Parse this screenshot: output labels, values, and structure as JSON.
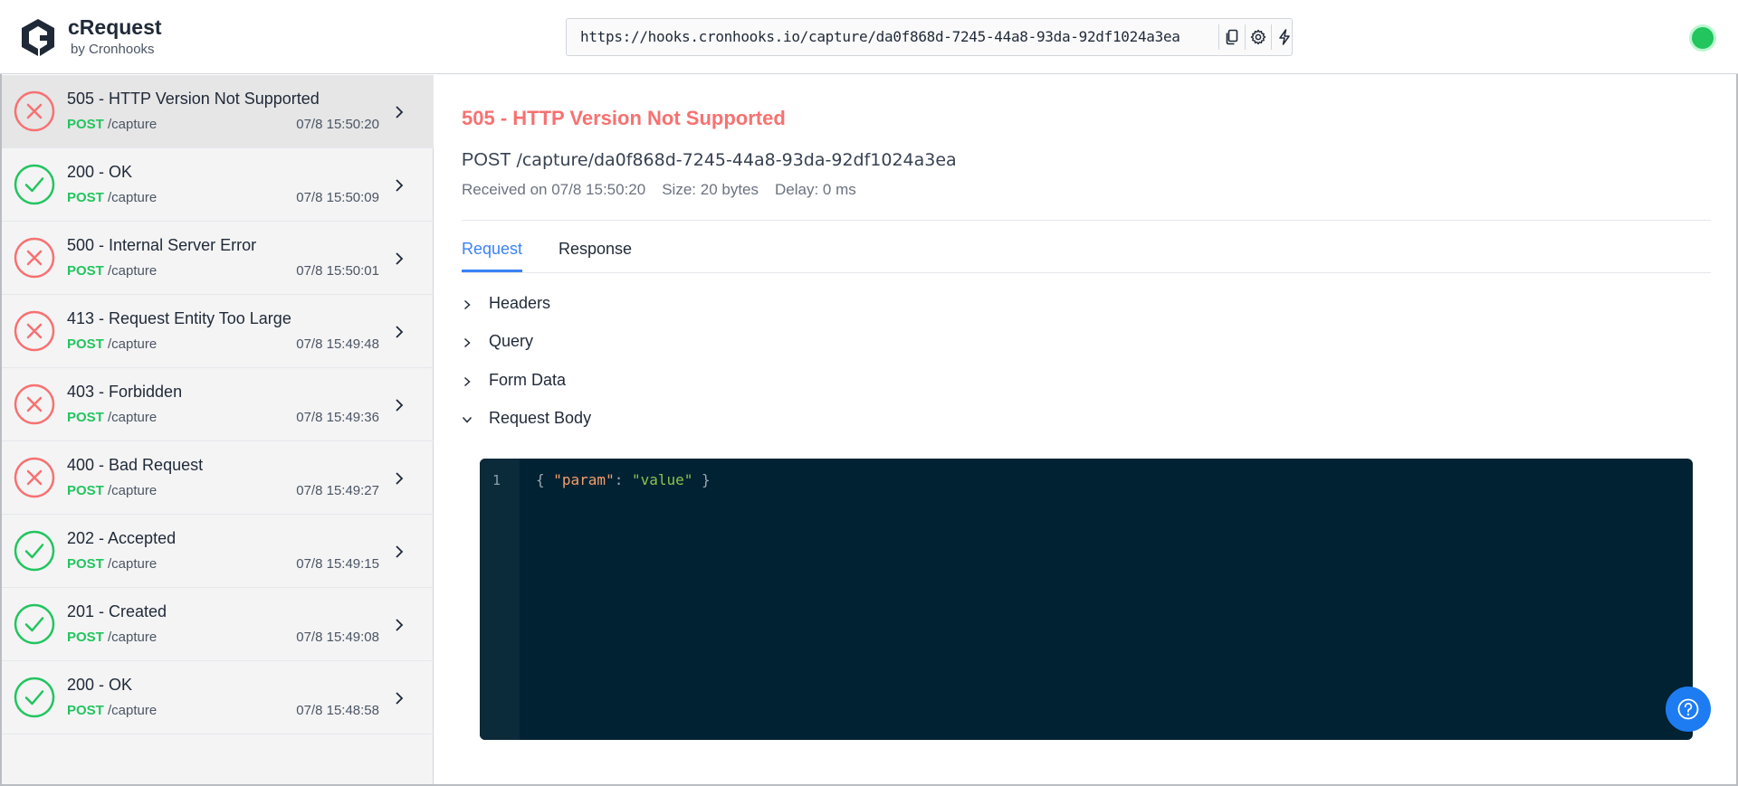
{
  "brand": {
    "title": "cRequest",
    "subtitle": "by Cronhooks"
  },
  "url_bar": {
    "value": "https://hooks.cronhooks.io/capture/da0f868d-7245-44a8-93da-92df1024a3ea",
    "icons": [
      "copy-icon",
      "gear-icon",
      "bolt-icon"
    ]
  },
  "status": {
    "color": "#22c55e",
    "state": "connected"
  },
  "requests": [
    {
      "title": "505 - HTTP Version Not Supported",
      "method": "POST",
      "path": "/capture",
      "time": "07/8 15:50:20",
      "state": "error",
      "active": true
    },
    {
      "title": "200 - OK",
      "method": "POST",
      "path": "/capture",
      "time": "07/8 15:50:09",
      "state": "success"
    },
    {
      "title": "500 - Internal Server Error",
      "method": "POST",
      "path": "/capture",
      "time": "07/8 15:50:01",
      "state": "error"
    },
    {
      "title": "413 - Request Entity Too Large",
      "method": "POST",
      "path": "/capture",
      "time": "07/8 15:49:48",
      "state": "error"
    },
    {
      "title": "403 - Forbidden",
      "method": "POST",
      "path": "/capture",
      "time": "07/8 15:49:36",
      "state": "error"
    },
    {
      "title": "400 - Bad Request",
      "method": "POST",
      "path": "/capture",
      "time": "07/8 15:49:27",
      "state": "error"
    },
    {
      "title": "202 - Accepted",
      "method": "POST",
      "path": "/capture",
      "time": "07/8 15:49:15",
      "state": "success"
    },
    {
      "title": "201 - Created",
      "method": "POST",
      "path": "/capture",
      "time": "07/8 15:49:08",
      "state": "success"
    },
    {
      "title": "200 - OK",
      "method": "POST",
      "path": "/capture",
      "time": "07/8 15:48:58",
      "state": "success"
    }
  ],
  "detail": {
    "title": "505 - HTTP Version Not Supported",
    "method": "POST",
    "path": "/capture/da0f868d-7245-44a8-93da-92df1024a3ea",
    "received": "Received on 07/8 15:50:20",
    "size": "Size: 20 bytes",
    "delay": "Delay: 0 ms",
    "tabs": [
      {
        "label": "Request",
        "active": true
      },
      {
        "label": "Response",
        "active": false
      }
    ],
    "sections": [
      {
        "label": "Headers",
        "expanded": false
      },
      {
        "label": "Query",
        "expanded": false
      },
      {
        "label": "Form Data",
        "expanded": false
      },
      {
        "label": "Request Body",
        "expanded": true
      }
    ],
    "body": {
      "line_number": "1",
      "open": "{ ",
      "key": "\"param\"",
      "colon": ": ",
      "value": "\"value\"",
      "close": " }"
    }
  },
  "colors": {
    "error": "#f87171",
    "success": "#22c55e",
    "accent": "#3b82f6",
    "code_bg": "#002233",
    "help": "#1d7cf2"
  }
}
